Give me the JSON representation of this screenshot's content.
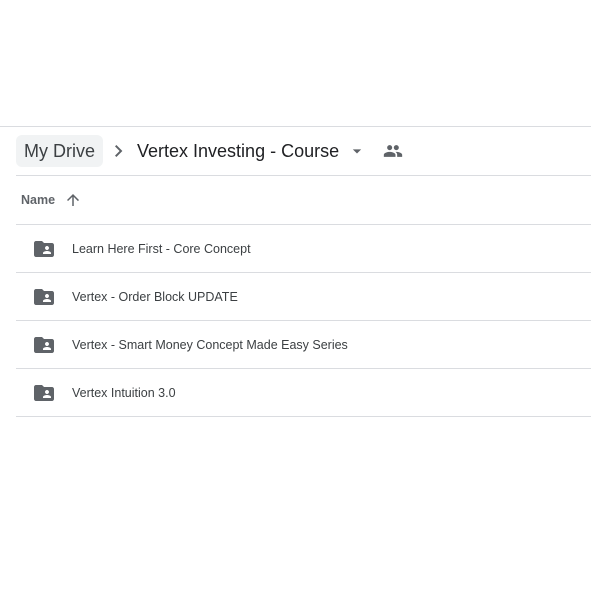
{
  "breadcrumb": {
    "root": "My Drive",
    "current": "Vertex Investing - Course",
    "separator_icon": "chevron-right-icon",
    "dropdown_icon": "caret-down-icon",
    "shared_icon": "people-icon"
  },
  "list": {
    "column_name": "Name",
    "sort_icon": "arrow-upward-icon",
    "item_icon": "shared-folder-icon",
    "items": [
      {
        "label": "Learn Here First - Core Concept"
      },
      {
        "label": "Vertex - Order Block UPDATE"
      },
      {
        "label": "Vertex - Smart Money Concept Made Easy Series"
      },
      {
        "label": "Vertex Intuition 3.0"
      }
    ]
  },
  "colors": {
    "icon": "#5f6368",
    "divider": "#dadce0",
    "root_chip": "#f1f3f4",
    "text": "#3c4043"
  }
}
